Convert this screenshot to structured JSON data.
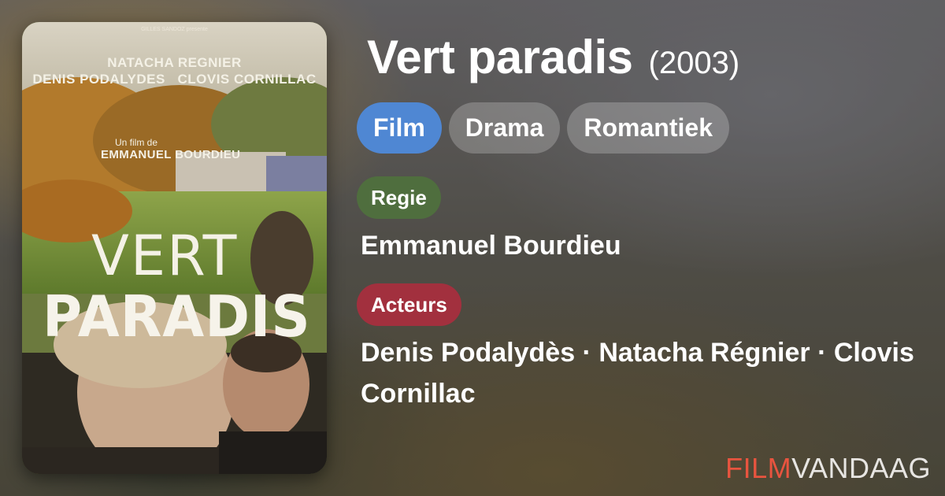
{
  "movie": {
    "title": "Vert paradis",
    "year": "(2003)"
  },
  "tags": [
    {
      "label": "Film",
      "color": "#4f87d3"
    },
    {
      "label": "Drama"
    },
    {
      "label": "Romantiek"
    }
  ],
  "regie": {
    "label": "Regie",
    "color": "#4f6e3e",
    "names": "Emmanuel Bourdieu"
  },
  "acteurs": {
    "label": "Acteurs",
    "color": "#a2303e",
    "names": "Denis Podalydès · Natacha Régnier · Clovis Cornillac"
  },
  "poster": {
    "top_line": "GILLES SANDOZ presente",
    "credit_line1": "NATACHA REGNIER",
    "credit_line2": "DENIS PODALYDES   CLOVIS CORNILLAC",
    "director_small": "Un film de",
    "director_big": "EMMANUEL BOURDIEU",
    "title_line1": "VERT",
    "title_line2": "PARADIS"
  },
  "brand": {
    "part1": "FILM",
    "part2": "VANDAAG",
    "color1": "#e8543f"
  }
}
